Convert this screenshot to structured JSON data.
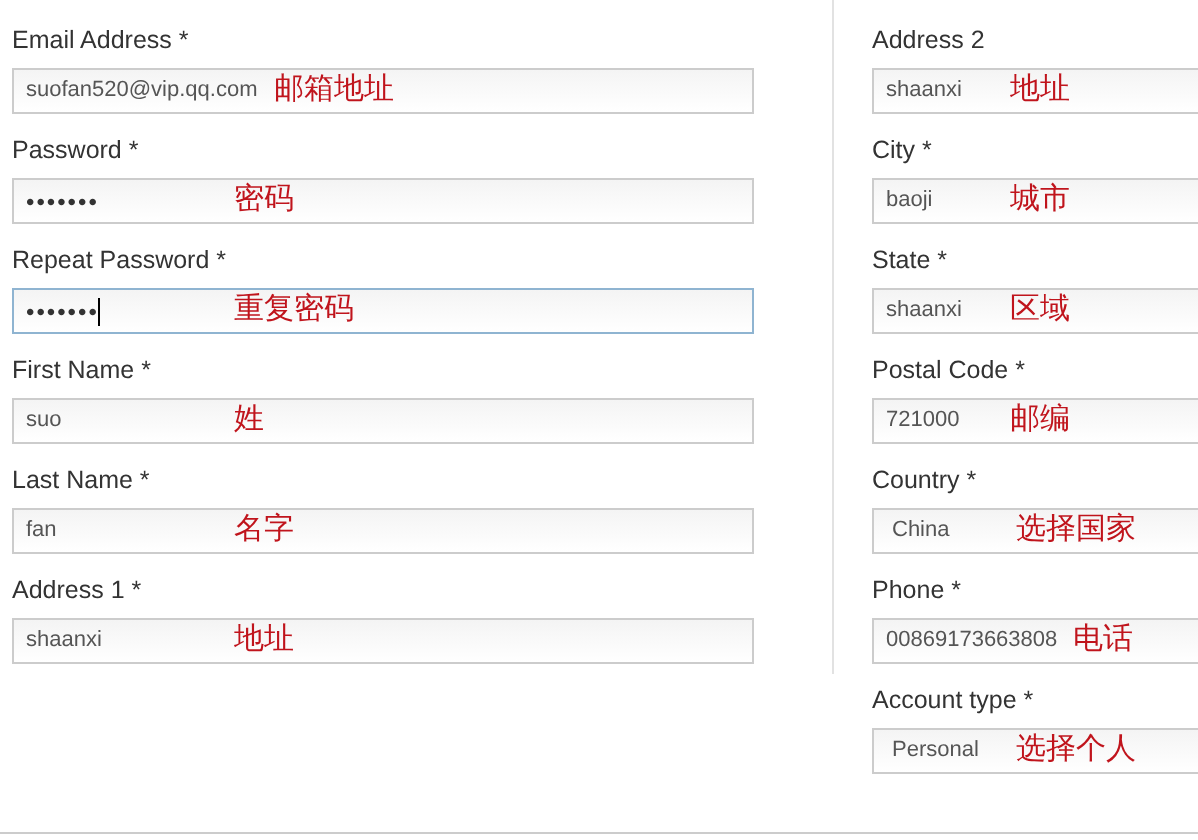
{
  "left_column": [
    {
      "label": "Email Address *",
      "kind": "text",
      "value": "suofan520@vip.qq.com",
      "focused": false,
      "note": "邮箱地址"
    },
    {
      "label": "Password *",
      "kind": "password",
      "value": "•••••••",
      "focused": false,
      "note": "密码"
    },
    {
      "label": "Repeat Password *",
      "kind": "password",
      "value": "•••••••",
      "focused": true,
      "note": "重复密码"
    },
    {
      "label": "First Name *",
      "kind": "text",
      "value": "suo",
      "focused": false,
      "note": "姓"
    },
    {
      "label": "Last Name *",
      "kind": "text",
      "value": "fan",
      "focused": false,
      "note": "名字"
    },
    {
      "label": "Address 1 *",
      "kind": "text",
      "value": "shaanxi",
      "focused": false,
      "note": "地址"
    }
  ],
  "right_column": [
    {
      "label": "Address 2",
      "kind": "text",
      "value": "shaanxi",
      "focused": false,
      "note": "地址"
    },
    {
      "label": "City *",
      "kind": "text",
      "value": "baoji",
      "focused": false,
      "note": "城市"
    },
    {
      "label": "State *",
      "kind": "text",
      "value": "shaanxi",
      "focused": false,
      "note": "区域"
    },
    {
      "label": "Postal Code *",
      "kind": "text",
      "value": "721000",
      "focused": false,
      "note": "邮编"
    },
    {
      "label": "Country *",
      "kind": "select",
      "value": "China",
      "focused": false,
      "note": "选择国家"
    },
    {
      "label": "Phone *",
      "kind": "text",
      "value": "00869173663808",
      "focused": false,
      "note": "电话"
    },
    {
      "label": "Account type *",
      "kind": "select",
      "value": "Personal",
      "focused": false,
      "note": "选择个人"
    }
  ]
}
